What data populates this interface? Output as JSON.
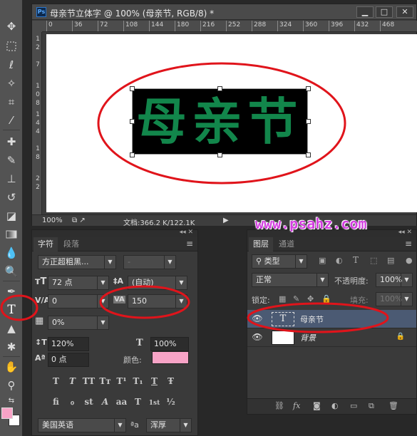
{
  "document": {
    "title": "母亲节立体字 @ 100% (母亲节, RGB/8) *",
    "app_badge": "Ps",
    "ruler_top": [
      "0",
      "36",
      "72",
      "108",
      "144",
      "180",
      "216",
      "252",
      "288",
      "324",
      "360",
      "396",
      "432",
      "468"
    ],
    "ruler_left": [
      "1",
      "2",
      "7",
      "1",
      "0",
      "8",
      "1",
      "4",
      "4",
      "1",
      "8",
      "2",
      "2"
    ],
    "canvas_text": "母亲节",
    "status_zoom": "100%",
    "status_doc": "文档:366.2 K/122.1K"
  },
  "character_panel": {
    "tabs": [
      "字符",
      "段落"
    ],
    "font_family": "方正超粗黑...",
    "font_style": "-",
    "font_size": "72 点",
    "leading": "(自动)",
    "kerning": "0",
    "tracking": "150",
    "scale_pct": "0%",
    "vertical_scale": "120%",
    "horizontal_scale": "100%",
    "baseline_shift": "0 点",
    "color_label": "颜色:",
    "style_buttons": [
      "T",
      "T",
      "TT",
      "Tт",
      "T¹",
      "T₁",
      "T",
      "Ŧ"
    ],
    "opentype_buttons": [
      "fi",
      "ℴ",
      "st",
      "A",
      "aa",
      "T",
      "1st",
      "½"
    ],
    "language": "美国英语",
    "aa_label": "ªa",
    "antialias": "浑厚"
  },
  "layers_panel": {
    "tabs": [
      "图层",
      "通道"
    ],
    "filter_kind": "类型",
    "blend_mode": "正常",
    "opacity_label": "不透明度:",
    "opacity": "100%",
    "lock_label": "锁定:",
    "fill_label": "填充:",
    "fill": "100%",
    "layers": [
      {
        "name": "母亲节",
        "type": "text",
        "selected": true
      },
      {
        "name": "背景",
        "type": "background",
        "selected": false
      }
    ],
    "bottom_icons": [
      "link-icon",
      "fx-icon",
      "mask-icon",
      "adjustment-icon",
      "folder-icon",
      "new-layer-icon",
      "trash-icon"
    ]
  },
  "watermark": "www.psahz.com",
  "colors": {
    "foreground": "#f7a3c6",
    "background": "#ffffff",
    "text_green": "#12864b",
    "annotation_red": "#e0141b",
    "watermark": "#d33fe0"
  }
}
